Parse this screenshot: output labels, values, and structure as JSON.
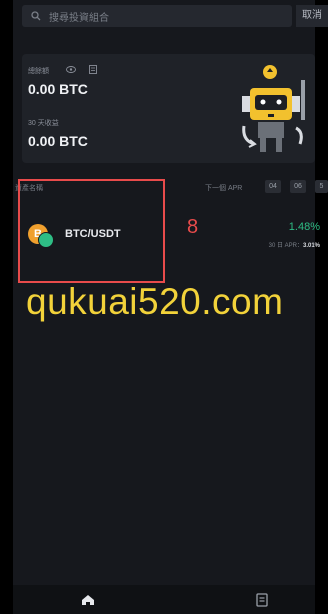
{
  "search": {
    "placeholder": "搜尋投資組合",
    "cancel": "取消"
  },
  "summary": {
    "total_label": "總餘額",
    "total_value": "0.00 BTC",
    "income_label": "30 天收益",
    "income_value": "0.00 BTC"
  },
  "list": {
    "col_left": "資產名稱",
    "col_right": "下一個 APR",
    "countdown": [
      "04",
      "06",
      "5"
    ]
  },
  "row": {
    "coin_glyph": "B",
    "pair": "BTC/USDT",
    "apr": "1.48%",
    "apr30_label": "30 日 APR：",
    "apr30_value": "3.01%"
  },
  "annotation": {
    "number": "8",
    "watermark": "qukuai520.com"
  },
  "colors": {
    "accent_green": "#2ebd85",
    "annotation_red": "#e84b4b",
    "watermark": "#f2d23a",
    "coin": "#f0a02e"
  },
  "icons": [
    "search-icon",
    "eye-icon",
    "history-icon",
    "robot-icon",
    "home-icon",
    "wallet-icon"
  ]
}
